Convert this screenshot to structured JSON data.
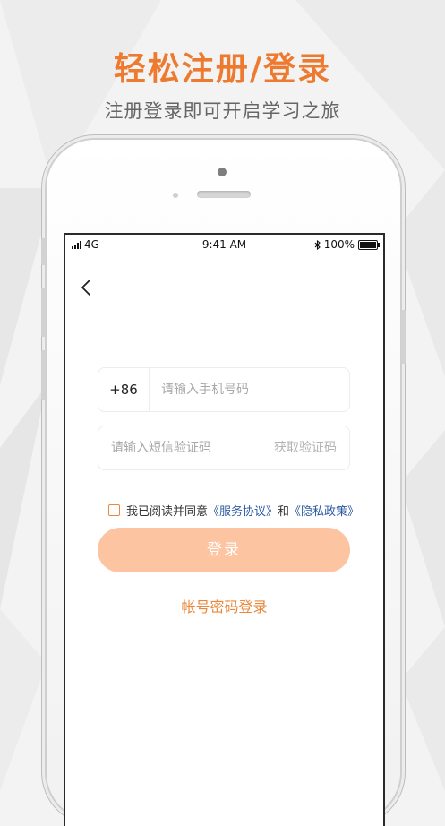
{
  "colors": {
    "accent": "#ee7a2f",
    "button_disabled": "#fcc4a0",
    "link": "#2c5aa0",
    "password_login": "#e8893f"
  },
  "header": {
    "title": "轻松注册/登录",
    "subtitle": "注册登录即可开启学习之旅"
  },
  "status_bar": {
    "network": "4G",
    "time": "9:41 AM",
    "battery": "100%",
    "icons": [
      "signal-icon",
      "bluetooth-icon",
      "battery-icon"
    ]
  },
  "nav": {
    "back_icon": "chevron-left-icon"
  },
  "phone_input": {
    "country_code": "+86",
    "placeholder": "请输入手机号码"
  },
  "code_input": {
    "placeholder": "请输入短信验证码",
    "get_code_label": "获取验证码"
  },
  "agreement": {
    "prefix": "我已阅读并同意",
    "service_link": "《服务协议》",
    "conjunction": "和",
    "privacy_link": "《隐私政策》",
    "checked": false
  },
  "login_button": {
    "label": "登录"
  },
  "password_login": {
    "label": "帐号密码登录"
  }
}
